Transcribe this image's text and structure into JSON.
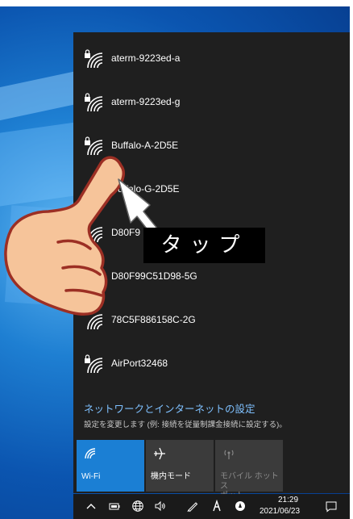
{
  "networks": [
    {
      "name": "aterm-9223ed-a",
      "secured": true
    },
    {
      "name": "aterm-9223ed-g",
      "secured": true
    },
    {
      "name": "Buffalo-A-2D5E",
      "secured": true
    },
    {
      "name": "Buffalo-G-2D5E",
      "secured": false
    },
    {
      "name": "D80F9",
      "secured": false
    },
    {
      "name": "D80F99C51D98-5G",
      "secured": false
    },
    {
      "name": "78C5F886158C-2G",
      "secured": false
    },
    {
      "name": "AirPort32468",
      "secured": true
    }
  ],
  "settings": {
    "link_label": "ネットワークとインターネットの設定",
    "description": "設定を変更します (例: 接続を従量制課金接続に設定する)。"
  },
  "tiles": {
    "wifi": {
      "label": "Wi-Fi",
      "active": true
    },
    "airplane": {
      "label": "機内モード",
      "active": false
    },
    "hotspot": {
      "label_line1": "モバイル ホットス",
      "label_line2": "ポット",
      "active": false
    }
  },
  "taskbar": {
    "time": "21:29",
    "date": "2021/06/23",
    "icons": [
      "chevron-up-icon",
      "battery-icon",
      "network-globe-icon",
      "volume-icon",
      "pen-icon",
      "ime-icon",
      "notification-badge-icon",
      "action-center-icon"
    ]
  },
  "annotation": {
    "label": "タップ"
  },
  "colors": {
    "flyout_bg": "#1f1f1f",
    "accent": "#1b7fd4",
    "link": "#7fc1ff",
    "finger_fill": "#f6c49a",
    "finger_outline": "#9c2f24"
  }
}
